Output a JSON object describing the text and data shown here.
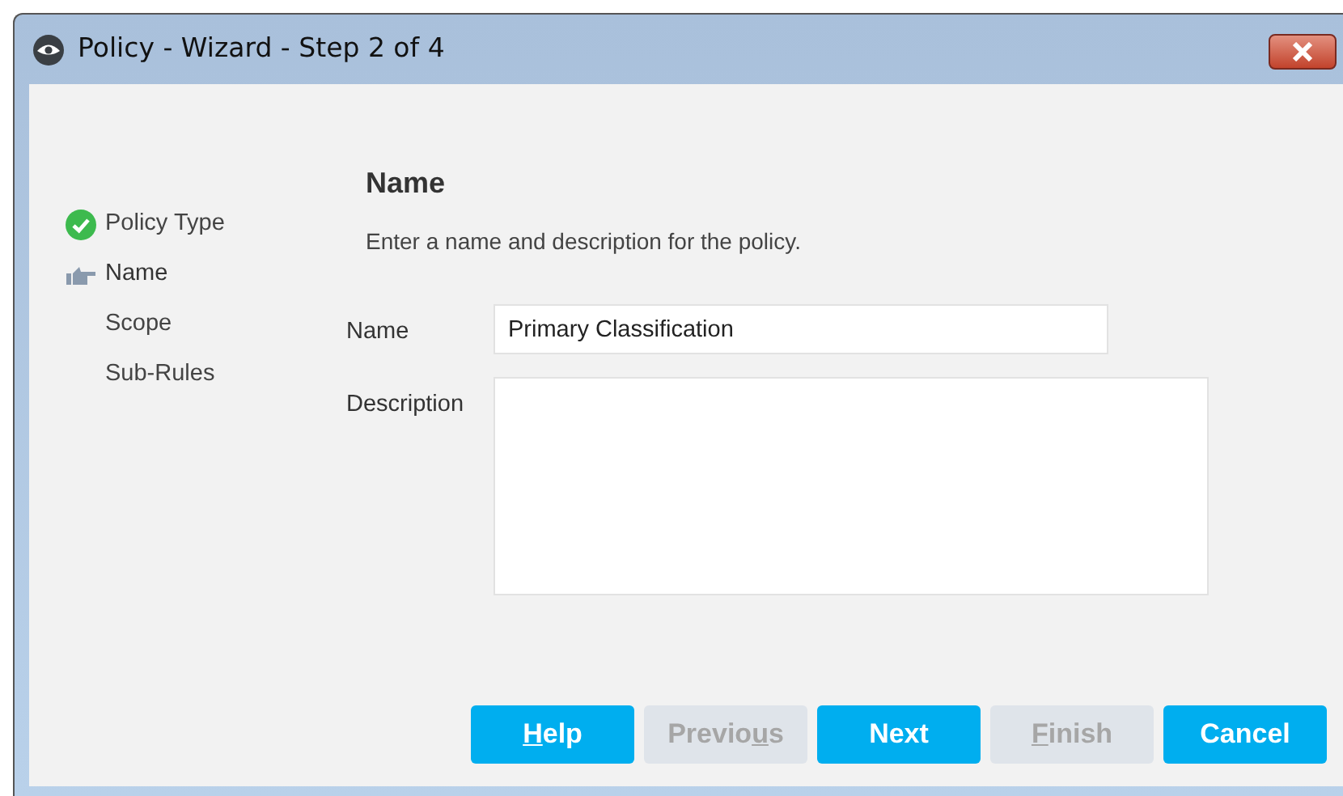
{
  "window": {
    "title": "Policy - Wizard - Step 2 of 4"
  },
  "steps": [
    {
      "label": "Policy Type",
      "kind": "done"
    },
    {
      "label": "Name",
      "kind": "current"
    },
    {
      "label": "Scope",
      "kind": "pending"
    },
    {
      "label": "Sub-Rules",
      "kind": "pending"
    }
  ],
  "page": {
    "heading": "Name",
    "description": "Enter a name and description for the policy."
  },
  "fields": [
    {
      "label": "Name",
      "value": "Primary Classification",
      "kind": "line"
    },
    {
      "label": "Description",
      "kind": "area"
    }
  ],
  "buttons": [
    {
      "key": "H",
      "post": "elp",
      "disabled": false
    },
    {
      "pre": "Previo",
      "key": "u",
      "post": "s",
      "disabled": true
    },
    {
      "pre": "Next",
      "disabled": false
    },
    {
      "key": "F",
      "post": "inish",
      "disabled": true
    },
    {
      "pre": "Cancel",
      "disabled": false
    }
  ]
}
